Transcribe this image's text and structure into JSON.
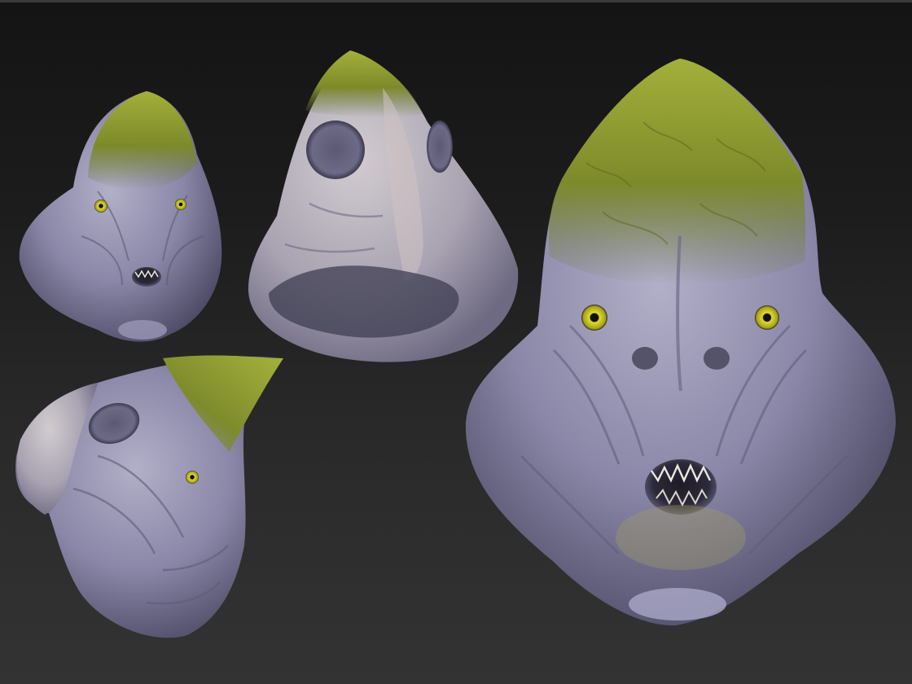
{
  "scene": {
    "background_top": "#141414",
    "background_bottom": "#333333",
    "views": [
      {
        "id": "front-small",
        "label": "",
        "kind": "front"
      },
      {
        "id": "top",
        "label": "",
        "kind": "top"
      },
      {
        "id": "side",
        "label": "",
        "kind": "side"
      },
      {
        "id": "front-large",
        "label": "",
        "kind": "front"
      }
    ],
    "skin_color": "#8a87a8",
    "skin_highlight": "#b9b6c8",
    "moss_color": "#8c9a2c",
    "eye_color": "#d6d22a"
  }
}
